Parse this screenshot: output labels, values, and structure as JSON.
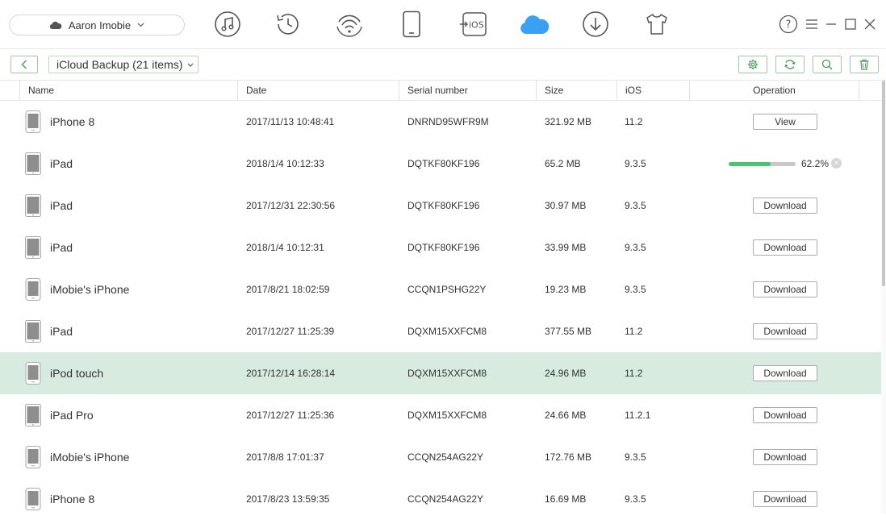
{
  "device_selector": {
    "label": "Aaron Imobie"
  },
  "toolbar": {
    "icons": [
      "music-icon",
      "history-icon",
      "wifi-sync-icon",
      "phone-icon",
      "ios-mover-icon",
      "icloud-icon",
      "download-icon",
      "tshirt-icon"
    ]
  },
  "window_controls": {
    "help": "?",
    "menu": "≡"
  },
  "subbar": {
    "title": "iCloud Backup (21 items)"
  },
  "columns": {
    "name": "Name",
    "date": "Date",
    "serial": "Serial number",
    "size": "Size",
    "ios": "iOS",
    "operation": "Operation"
  },
  "rows": [
    {
      "name": "iPhone 8",
      "date": "2017/11/13 10:48:41",
      "serial": "DNRND95WFR9M",
      "size": "321.92 MB",
      "ios": "11.2",
      "op": "View"
    },
    {
      "name": "iPad",
      "date": "2018/1/4 10:12:33",
      "serial": "DQTKF80KF196",
      "size": "65.2 MB",
      "ios": "9.3.5",
      "progress": 0.622,
      "progress_label": "62.2%"
    },
    {
      "name": "iPad",
      "date": "2017/12/31 22:30:56",
      "serial": "DQTKF80KF196",
      "size": "30.97 MB",
      "ios": "9.3.5",
      "op": "Download"
    },
    {
      "name": "iPad",
      "date": "2018/1/4 10:12:31",
      "serial": "DQTKF80KF196",
      "size": "33.99 MB",
      "ios": "9.3.5",
      "op": "Download"
    },
    {
      "name": "iMobie's iPhone",
      "date": "2017/8/21 18:02:59",
      "serial": "CCQN1PSHG22Y",
      "size": "19.23 MB",
      "ios": "9.3.5",
      "op": "Download"
    },
    {
      "name": "iPad",
      "date": "2017/12/27 11:25:39",
      "serial": "DQXM15XXFCM8",
      "size": "377.55 MB",
      "ios": "11.2",
      "op": "Download"
    },
    {
      "name": "iPod touch",
      "date": "2017/12/14 16:28:14",
      "serial": "DQXM15XXFCM8",
      "size": "24.96 MB",
      "ios": "11.2",
      "op": "Download",
      "selected": true
    },
    {
      "name": "iPad Pro",
      "date": "2017/12/27 11:25:36",
      "serial": "DQXM15XXFCM8",
      "size": "24.66 MB",
      "ios": "11.2.1",
      "op": "Download"
    },
    {
      "name": "iMobie's iPhone",
      "date": "2017/8/8 17:01:37",
      "serial": "CCQN254AG22Y",
      "size": "172.76 MB",
      "ios": "9.3.5",
      "op": "Download"
    },
    {
      "name": "iPhone 8",
      "date": "2017/8/23 13:59:35",
      "serial": "CCQN254AG22Y",
      "size": "16.69 MB",
      "ios": "9.3.5",
      "op": "Download"
    }
  ],
  "colors": {
    "accent": "#42c96b",
    "cloud": "#3aa0f2",
    "selected_row": "#d8ebe0",
    "icon_gray": "#555555"
  }
}
